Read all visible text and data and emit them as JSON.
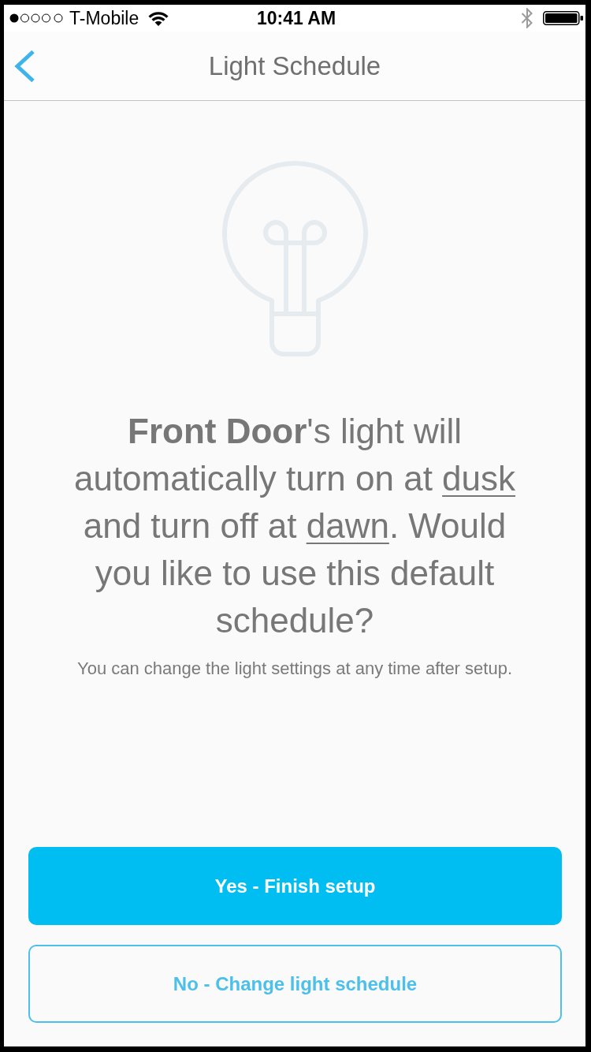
{
  "status_bar": {
    "carrier": "T-Mobile",
    "time": "10:41 AM"
  },
  "nav_bar": {
    "title": "Light Schedule"
  },
  "message": {
    "parts": [
      {
        "kind": "bold",
        "text": "Front Door"
      },
      {
        "kind": "text",
        "text": "'s light will automatically turn on at "
      },
      {
        "kind": "link",
        "text": "dusk"
      },
      {
        "kind": "text",
        "text": " and turn off at "
      },
      {
        "kind": "link",
        "text": "dawn"
      },
      {
        "kind": "text",
        "text": ". Would you like to use this default schedule?"
      }
    ]
  },
  "note": "You can change the light settings at any time after setup.",
  "buttons": [
    {
      "kind": "primary",
      "label": "Yes - Finish setup"
    },
    {
      "kind": "outline",
      "label": "No - Change light schedule"
    }
  ]
}
